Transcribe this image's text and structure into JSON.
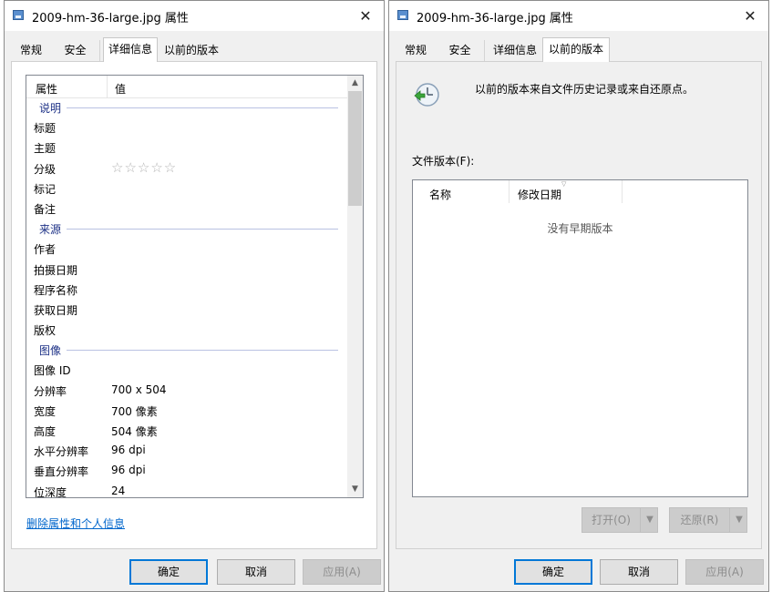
{
  "left_window": {
    "title": "2009-hm-36-large.jpg 属性",
    "close_icon": "close-icon",
    "tabs": [
      "常规",
      "安全",
      "详细信息",
      "以前的版本"
    ],
    "active_tab": "详细信息",
    "list": {
      "header_property": "属性",
      "header_value": "值",
      "groups": [
        {
          "name": "说明",
          "rows": [
            {
              "k": "标题",
              "v": ""
            },
            {
              "k": "主题",
              "v": ""
            },
            {
              "k": "分级",
              "v": "",
              "stars": 5
            },
            {
              "k": "标记",
              "v": ""
            },
            {
              "k": "备注",
              "v": ""
            }
          ]
        },
        {
          "name": "来源",
          "rows": [
            {
              "k": "作者",
              "v": ""
            },
            {
              "k": "拍摄日期",
              "v": ""
            },
            {
              "k": "程序名称",
              "v": ""
            },
            {
              "k": "获取日期",
              "v": ""
            },
            {
              "k": "版权",
              "v": ""
            }
          ]
        },
        {
          "name": "图像",
          "rows": [
            {
              "k": "图像 ID",
              "v": ""
            },
            {
              "k": "分辨率",
              "v": "700 x 504"
            },
            {
              "k": "宽度",
              "v": "700 像素"
            },
            {
              "k": "高度",
              "v": "504 像素"
            },
            {
              "k": "水平分辨率",
              "v": "96 dpi"
            },
            {
              "k": "垂直分辨率",
              "v": "96 dpi"
            },
            {
              "k": "位深度",
              "v": "24"
            }
          ]
        }
      ]
    },
    "remove_link": "删除属性和个人信息",
    "buttons": {
      "ok": "确定",
      "cancel": "取消",
      "apply": "应用(A)"
    }
  },
  "right_window": {
    "title": "2009-hm-36-large.jpg 属性",
    "close_icon": "close-icon",
    "tabs": [
      "常规",
      "安全",
      "详细信息",
      "以前的版本"
    ],
    "active_tab": "以前的版本",
    "info_text": "以前的版本来自文件历史记录或来自还原点。",
    "file_versions_label": "文件版本(F):",
    "col_name": "名称",
    "col_modified": "修改日期",
    "empty_text": "没有早期版本",
    "open_button": "打开(O)",
    "restore_button": "还原(R)",
    "buttons": {
      "ok": "确定",
      "cancel": "取消",
      "apply": "应用(A)"
    }
  }
}
